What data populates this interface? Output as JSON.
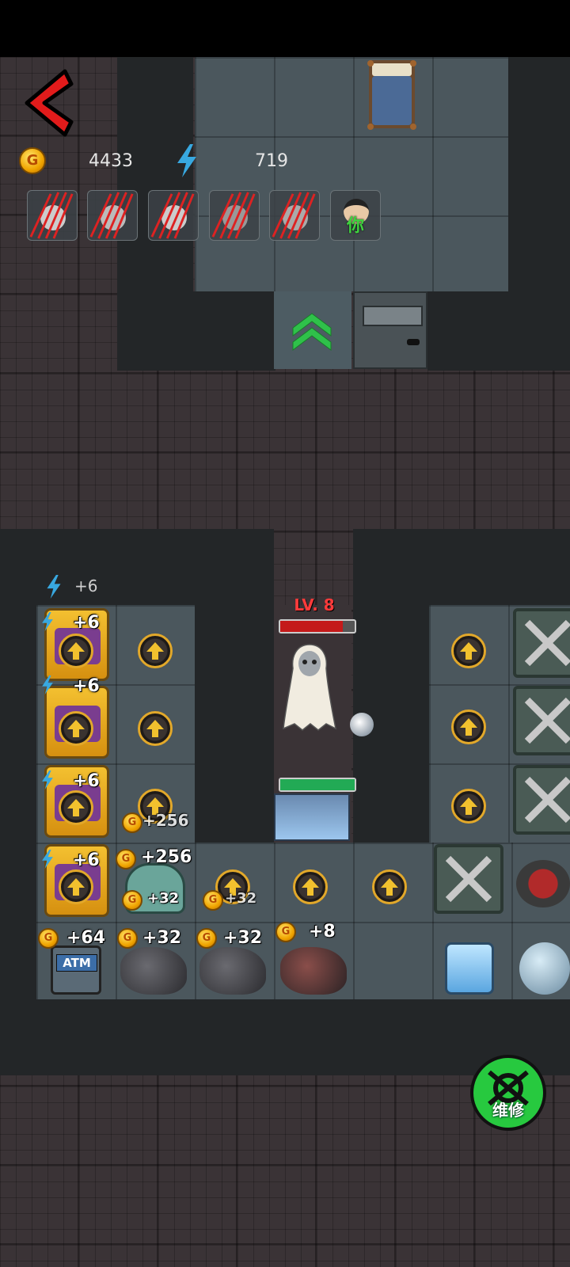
{
  "hud": {
    "gold": "4433",
    "energy": "719",
    "income_energy": "+6"
  },
  "players": [
    {
      "name": "player-slot-1",
      "dead": true
    },
    {
      "name": "player-slot-2",
      "dead": true
    },
    {
      "name": "player-slot-3",
      "dead": true
    },
    {
      "name": "player-slot-4",
      "dead": true
    },
    {
      "name": "player-slot-5",
      "dead": true
    },
    {
      "name": "player-slot-6",
      "label": "你",
      "dead": false
    }
  ],
  "ghost": {
    "level": "LV. 8",
    "hp": 0.84
  },
  "door": {
    "hp": 1.0
  },
  "tiles": {
    "col1": [
      "+6",
      "+6",
      "+6",
      "+6",
      "+64"
    ],
    "col2_r3": "+256",
    "col2_r4_top": "+256",
    "col2_r4_bottom": "+32",
    "col2_r5": "+32",
    "col3_r4": "+32",
    "col3_r5": "+32",
    "col4_r5": "+8",
    "atm_label": "ATM"
  },
  "repair": {
    "label": "维修"
  },
  "colors": {
    "gold": "#f0a400",
    "energy": "#38a8e0",
    "repair_green": "#27c93f",
    "hp_red": "#c41a1a",
    "door_green": "#22aa55"
  }
}
